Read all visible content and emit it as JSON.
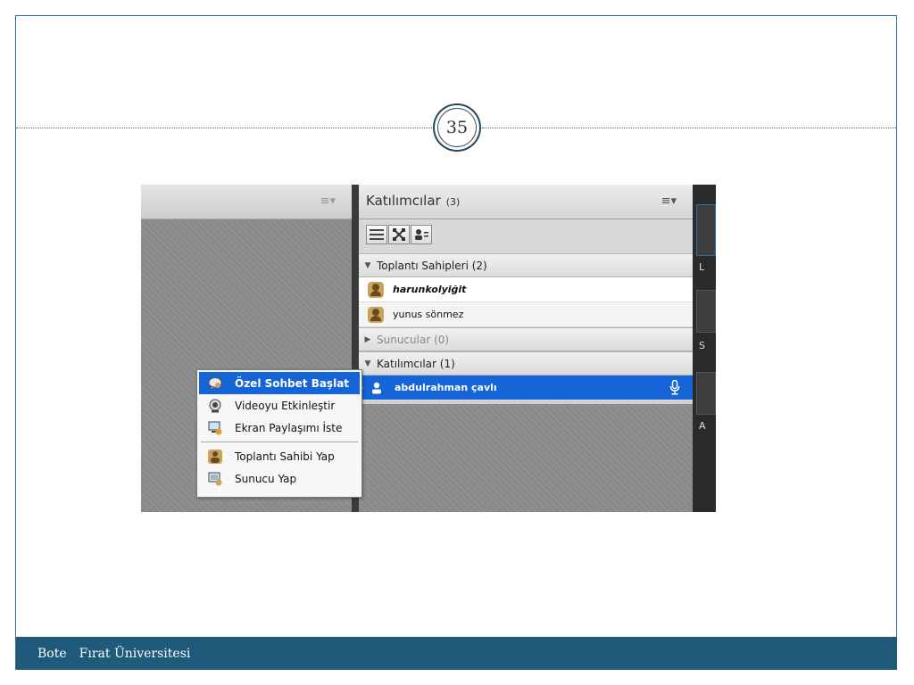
{
  "slide": {
    "page_number": "35",
    "footer": {
      "left": "Bote",
      "right": "Fırat Üniversitesi"
    }
  },
  "screenshot": {
    "left_pod": {
      "menu_icon": "≡▾"
    },
    "attendees_pod": {
      "title": "Katılımcılar",
      "count": "(3)",
      "menu_icon": "≡▾",
      "view_buttons": [
        {
          "name": "list-view",
          "icon": "list-icon"
        },
        {
          "name": "grid-view",
          "icon": "grid-icon"
        },
        {
          "name": "role-view",
          "icon": "roles-icon"
        }
      ],
      "sections": [
        {
          "label": "Toplantı Sahipleri (2)",
          "expanded": true
        },
        {
          "label": "Sunucular (0)",
          "expanded": false
        },
        {
          "label": "Katılımcılar (1)",
          "expanded": true
        }
      ],
      "hosts": [
        {
          "name": "harunkolyiğit",
          "style": "bold-italic"
        },
        {
          "name": "yunus sönmez",
          "style": "normal"
        }
      ],
      "participants": [
        {
          "name": "abdulrahman çavlı",
          "selected": true,
          "mic": true
        }
      ]
    },
    "right_edge_letters": [
      "L",
      "S",
      "A"
    ],
    "context_menu": {
      "items": [
        {
          "label": "Özel Sohbet Başlat",
          "icon": "chat-icon",
          "active": true
        },
        {
          "label": "Videoyu Etkinleştir",
          "icon": "webcam-icon",
          "active": false
        },
        {
          "label": "Ekran Paylaşımı İste",
          "icon": "screen-share-icon",
          "active": false
        },
        {
          "label": "Toplantı Sahibi Yap",
          "icon": "host-icon",
          "active": false
        },
        {
          "label": "Sunucu Yap",
          "icon": "presenter-icon",
          "active": false
        }
      ]
    }
  }
}
